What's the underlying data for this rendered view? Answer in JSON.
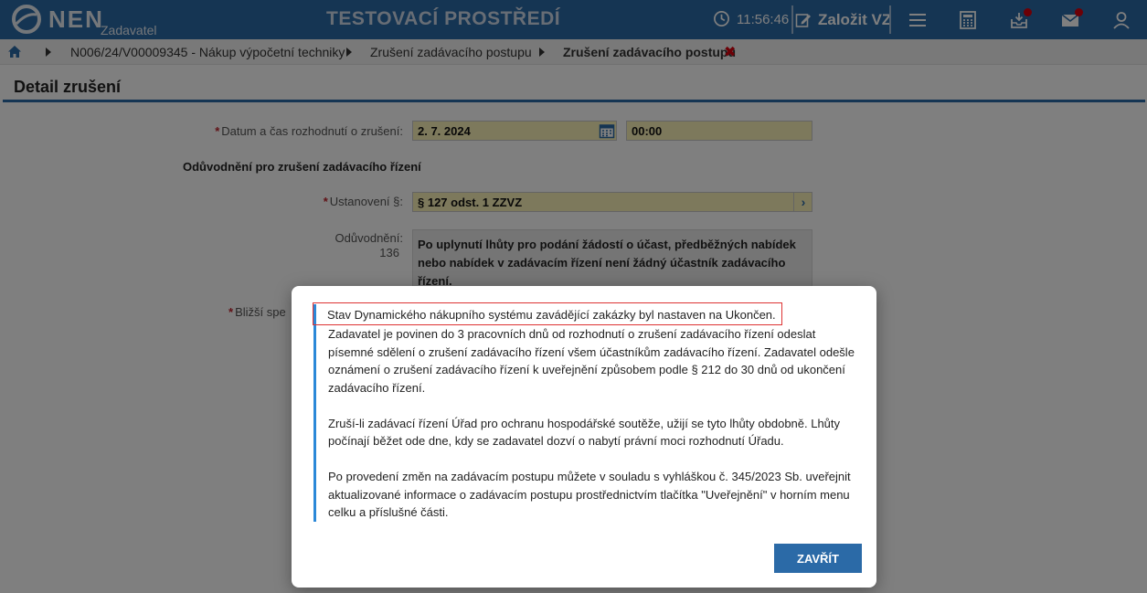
{
  "header": {
    "logo_text": "NEN",
    "logo_sub": "Zadavatel",
    "env_title": "TESTOVACÍ PROSTŘEDÍ",
    "clock": "11:56:46",
    "create_label": "Založit VZ"
  },
  "breadcrumb": {
    "items": [
      "N006/24/V00009345 - Nákup výpočetní techniky",
      "Zrušení zadávacího postupu"
    ],
    "current": "Zrušení zadávacího postupu"
  },
  "page": {
    "title": "Detail zrušení"
  },
  "form": {
    "decision_label": "Datum a čas rozhodnutí o zrušení:",
    "decision_date": "2. 7. 2024",
    "decision_time": "00:00",
    "section_title": "Odůvodnění pro zrušení zadávacího řízení",
    "provision_label": "Ustanovení §:",
    "provision_value": "§ 127 odst. 1 ZZVZ",
    "justification_label": "Odůvodnění:",
    "justification_count": "136",
    "justification_text": "Po uplynutí lhůty pro podání žádostí o účast, předběžných nabídek nebo nabídek v zadávacím řízení není žádný účastník zadávacího řízení.",
    "detail_label": "Bližší spe"
  },
  "modal": {
    "first_line": "Stav Dynamického nákupního systému zavádějící zakázky byl nastaven na Ukončen.",
    "paragraph1": "Zadavatel je povinen do 3 pracovních dnů od rozhodnutí o zrušení zadávacího řízení odeslat písemné sdělení o zrušení zadávacího řízení všem účastníkům zadávacího řízení. Zadavatel odešle oznámení o zrušení zadávacího řízení k uveřejnění způsobem podle § 212 do 30 dnů od ukončení zadávacího řízení.",
    "paragraph2": "Zruší-li zadávací řízení Úřad pro ochranu hospodářské soutěže, užijí se tyto lhůty obdobně. Lhůty počínají běžet ode dne, kdy se zadavatel dozví o nabytí právní moci rozhodnutí Úřadu.",
    "paragraph3": "Po provedení změn na zadávacím postupu můžete v souladu s vyhláškou č. 345/2023 Sb. uveřejnit aktualizované informace o zadávacím postupu prostřednictvím tlačítka \"Uveřejnění\" v horním menu celku a příslušné části.",
    "close_label": "ZAVŘÍT"
  },
  "colors": {
    "header_bg": "#2b6aa7",
    "field_bg": "#fbf2b8",
    "badge": "#d9000d",
    "accent": "#2b88d8"
  }
}
